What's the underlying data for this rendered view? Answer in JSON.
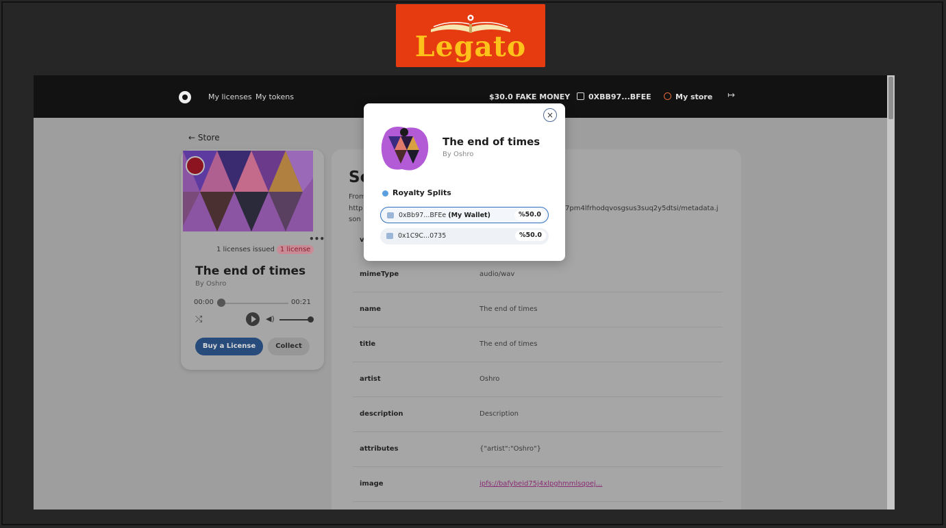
{
  "logo": {
    "text": "Legato"
  },
  "navbar": {
    "links": [
      "My licenses",
      "My tokens"
    ],
    "balance": "$30.0 FAKE MONEY",
    "wallet": "0XBB97...BFEE",
    "store": "My store",
    "logout_icon": "logout-icon"
  },
  "back": "← Store",
  "card": {
    "issued": "1 licenses issued",
    "pill": "1 license",
    "title": "The end of times",
    "by": "By Oshro",
    "time_start": "00:00",
    "time_end": "00:21",
    "buy": "Buy a License",
    "collect": "Collect",
    "dots": "•••"
  },
  "panel": {
    "title_partial": "Sc",
    "from_partial": "From",
    "url_start": "http",
    "url_end": "7pm4lfrhodqvosgsus3suq2y5dtsi/metadata.j",
    "url_line2": "son",
    "row_partial": "v",
    "rows": [
      {
        "key": "mimeType",
        "value": "audio/wav"
      },
      {
        "key": "name",
        "value": "The end of times"
      },
      {
        "key": "title",
        "value": "The end of times"
      },
      {
        "key": "artist",
        "value": "Oshro"
      },
      {
        "key": "description",
        "value": "Description"
      },
      {
        "key": "attributes",
        "value": "{\"artist\":\"Oshro\"}"
      },
      {
        "key": "image",
        "value": "ipfs://bafybeid75j4xlpghmmlsqoej..."
      }
    ]
  },
  "modal": {
    "close": "×",
    "title": "The end of times",
    "by": "By Oshro",
    "section": "Royalty Splits",
    "splits": [
      {
        "address": "0xBb97...BFEe",
        "tag": "(My Wallet)",
        "percent": "%50.0"
      },
      {
        "address": "0x1C9C...0735",
        "tag": "",
        "percent": "%50.0"
      }
    ]
  },
  "colors": {
    "logo_bg": "#e63b10",
    "logo_text": "#ffc21a",
    "primary": "#2e6fbf",
    "accent": "#e06a3a"
  }
}
